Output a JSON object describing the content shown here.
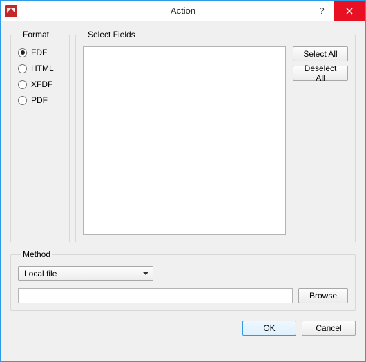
{
  "window": {
    "title": "Action"
  },
  "format": {
    "legend": "Format",
    "options": [
      {
        "label": "FDF",
        "selected": true
      },
      {
        "label": "HTML",
        "selected": false
      },
      {
        "label": "XFDF",
        "selected": false
      },
      {
        "label": "PDF",
        "selected": false
      }
    ]
  },
  "fields": {
    "legend": "Select Fields",
    "select_all": "Select All",
    "deselect_all": "Deselect All"
  },
  "method": {
    "legend": "Method",
    "selected": "Local file",
    "path": "",
    "browse": "Browse"
  },
  "footer": {
    "ok": "OK",
    "cancel": "Cancel"
  }
}
